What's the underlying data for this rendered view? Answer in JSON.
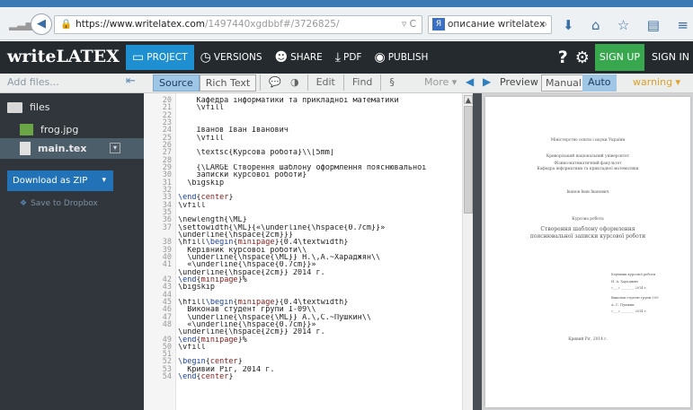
{
  "browser": {
    "url_host": "https://www.writelatex.com",
    "url_path": "/1497440xgdbbf#/3726825/",
    "search_text": "описание writelatex",
    "search_engine_icon": "yandex-icon",
    "icons": [
      "download-arrow-icon",
      "home-icon",
      "star-icon",
      "bookmark-list-icon",
      "menu-icon"
    ]
  },
  "app": {
    "logo": "writeLATEX",
    "nav": [
      {
        "label": "PROJECT",
        "icon": "folder-icon"
      },
      {
        "label": "VERSIONS",
        "icon": "clock-icon"
      },
      {
        "label": "SHARE",
        "icon": "people-icon"
      },
      {
        "label": "PDF",
        "icon": "download-icon"
      },
      {
        "label": "PUBLISH",
        "icon": "globe-icon"
      }
    ],
    "help": "?",
    "signup": "SIGN UP",
    "signin": "SIGN IN"
  },
  "toolbar": {
    "add_files": "Add files...",
    "source": "Source",
    "rich_text": "Rich Text",
    "edit": "Edit",
    "find": "Find",
    "section": "§",
    "more": "More ▾",
    "preview": "Preview",
    "manual": "Manual",
    "auto": "Auto",
    "warning": "warning ▾"
  },
  "sidebar": {
    "folder": "files",
    "files": [
      "frog.jpg",
      "main.tex"
    ],
    "download": "Download as ZIP",
    "dropbox": "Save to Dropbox"
  },
  "editor": {
    "lines": [
      {
        "n": "20",
        "t": "    Кафедра інформатики та прикладної математики"
      },
      {
        "n": "21",
        "t": "    \\vfill"
      },
      {
        "n": "22",
        "t": ""
      },
      {
        "n": "23",
        "t": ""
      },
      {
        "n": "24",
        "t": "    Іванов Іван Іванович"
      },
      {
        "n": "25",
        "t": "    \\vfill"
      },
      {
        "n": "26",
        "t": ""
      },
      {
        "n": "27",
        "t": "    \\textsc{Курсова робота}\\\\[5mm]"
      },
      {
        "n": "28",
        "t": ""
      },
      {
        "n": "29",
        "t": "    {\\LARGE Створення шаблону оформлення пояснювальної"
      },
      {
        "n": "30",
        "t": "    записки курсової роботи}"
      },
      {
        "n": "31",
        "t": "  \\bigskip"
      },
      {
        "n": "32",
        "t": ""
      },
      {
        "n": "33",
        "t": "\\end{center}"
      },
      {
        "n": "34",
        "t": "\\vfill"
      },
      {
        "n": "35",
        "t": ""
      },
      {
        "n": "36",
        "t": "\\newlength{\\ML}"
      },
      {
        "n": "37",
        "t": "\\settowidth{\\ML}{«\\underline{\\hspace{0.7cm}}»"
      },
      {
        "n": "",
        "t": "\\underline{\\hspace{2cm}}}"
      },
      {
        "n": "38",
        "t": "\\hfill\\begin{minipage}{0.4\\textwidth}"
      },
      {
        "n": "39",
        "t": "  Керівник курсової роботи\\\\"
      },
      {
        "n": "40",
        "t": "  \\underline{\\hspace{\\ML}} Н.\\,А.~Хараджян\\\\"
      },
      {
        "n": "41",
        "t": "  «\\underline{\\hspace{0.7cm}}»"
      },
      {
        "n": "",
        "t": "\\underline{\\hspace{2cm}} 2014 г."
      },
      {
        "n": "42",
        "t": "\\end{minipage}%"
      },
      {
        "n": "43",
        "t": "\\bigskip"
      },
      {
        "n": "44",
        "t": ""
      },
      {
        "n": "45",
        "t": "\\hfill\\begin{minipage}{0.4\\textwidth}"
      },
      {
        "n": "46",
        "t": "  Виконав студент групи І-09\\\\"
      },
      {
        "n": "47",
        "t": "  \\underline{\\hspace{\\ML}} А.\\,С.~Пушкин\\\\"
      },
      {
        "n": "48",
        "t": "  «\\underline{\\hspace{0.7cm}}»"
      },
      {
        "n": "",
        "t": "\\underline{\\hspace{2cm}} 2014 г."
      },
      {
        "n": "49",
        "t": "\\end{minipage}%"
      },
      {
        "n": "50",
        "t": "\\vfill"
      },
      {
        "n": "51",
        "t": ""
      },
      {
        "n": "52",
        "t": "\\begin{center}"
      },
      {
        "n": "53",
        "t": "  Кривий Ріг, 2014 г."
      },
      {
        "n": "54",
        "t": "\\end{center}"
      }
    ]
  },
  "preview": {
    "ministry": "Міністерство освіти і науки України",
    "university": "Криворізький національний університет",
    "faculty": "Фізико-математичний факультет",
    "department": "Кафедра інформатики та прикладної математики",
    "author": "Іванов Іван Іванович",
    "kind": "Курсова робота",
    "title_line1": "Створення шаблону оформлення",
    "title_line2": "пояснювальної записки курсової роботи",
    "supervisor_label": "Керівник курсової роботи",
    "supervisor_name": "Н. А. Хараджян",
    "supervisor_date": "«___» ________ 2014 г.",
    "student_label": "Виконав студент групи І-09",
    "student_name": "А. С. Пушкин",
    "student_date": "«___» ________ 2014 г.",
    "city": "Кривий Ріг, 2014 г."
  }
}
